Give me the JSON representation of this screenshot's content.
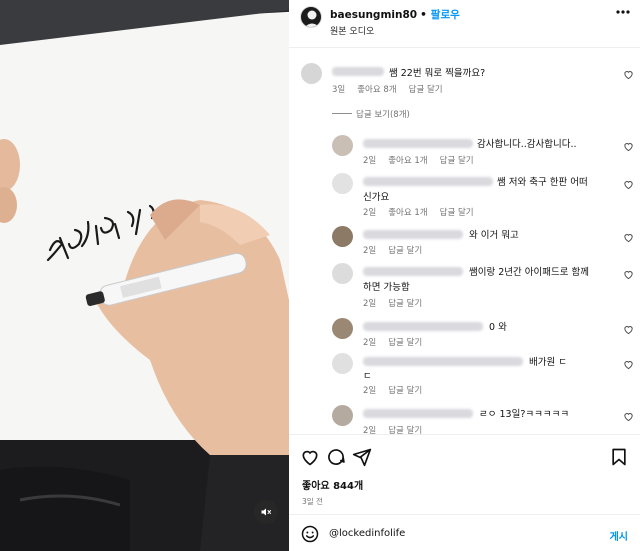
{
  "header": {
    "username": "baesungmin80",
    "separator": "•",
    "follow_label": "팔로우",
    "audio_label": "원본 오디오"
  },
  "video": {
    "written_text": "성공을 디자인"
  },
  "comments": [
    {
      "text": "쌤 22번 뭐로 찍을까요?",
      "time": "3일",
      "likes": "좋아요 8개",
      "reply": "답글 달기",
      "view_replies": "답글 보기(8개)"
    },
    {
      "text": "감사합니다..감사합니다..",
      "time": "2일",
      "likes": "좋아요 1개",
      "reply": "답글 달기"
    },
    {
      "text": "쌤 저와 축구 한판 어떠",
      "text2": "신가요",
      "time": "2일",
      "likes": "좋아요 1개",
      "reply": "답글 달기"
    },
    {
      "text": "와 이거 뭐고",
      "time": "2일",
      "reply": "답글 달기"
    },
    {
      "text": "쌤이랑 2년간 아이패드로 함께",
      "text2": "하면 가능함",
      "time": "2일",
      "reply": "답글 달기"
    },
    {
      "text": "0 와",
      "time": "2일",
      "reply": "답글 달기"
    },
    {
      "text": "배가원 ㄷ",
      "text2": "ㄷ",
      "time": "2일",
      "reply": "답글 달기"
    },
    {
      "text": "ㄹㅇ 13일?ㅋㅋㅋㅋㅋ",
      "time": "2일",
      "reply": "답글 달기"
    }
  ],
  "actions": {
    "likes": "좋아요 844개",
    "time": "3일 전"
  },
  "composer": {
    "handle": "@lockedinfolife",
    "post_label": "게시"
  },
  "colors": {
    "accent": "#0095f6",
    "muted": "#737373"
  },
  "icons": [
    "more-icon",
    "heart-icon",
    "comment-icon",
    "share-icon",
    "bookmark-icon",
    "emoji-icon",
    "mute-icon"
  ]
}
